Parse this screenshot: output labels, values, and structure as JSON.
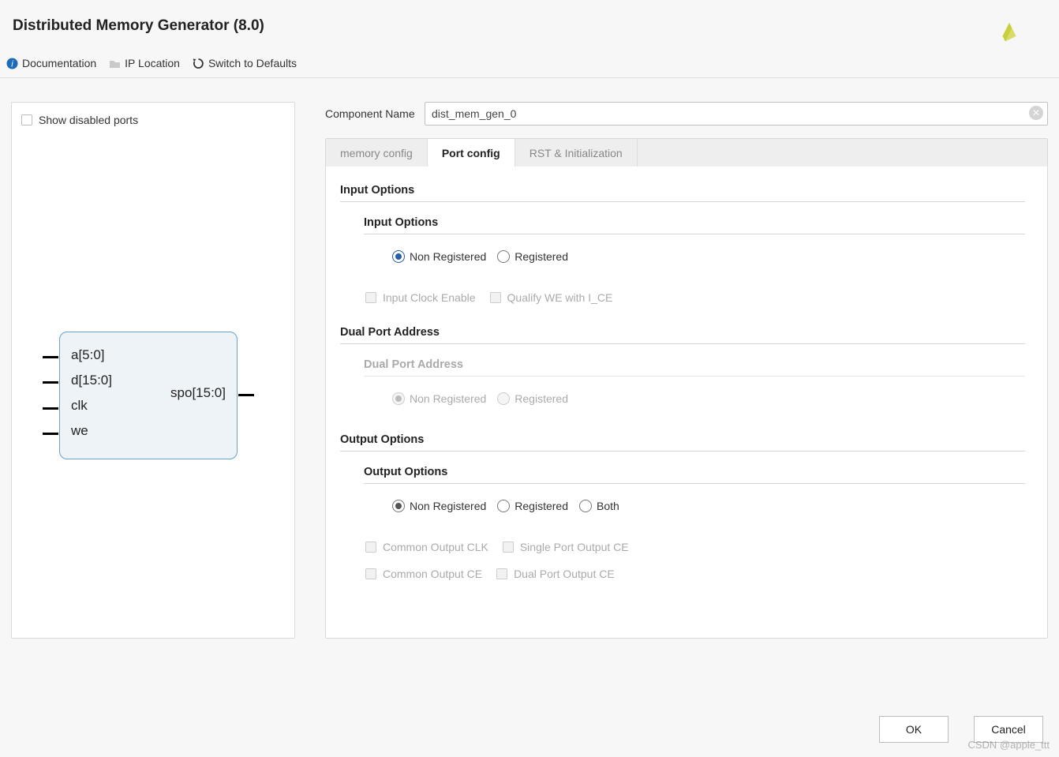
{
  "header": {
    "title": "Distributed Memory Generator (8.0)"
  },
  "toolbar": {
    "documentation": "Documentation",
    "ip_location": "IP Location",
    "switch_defaults": "Switch to Defaults"
  },
  "preview": {
    "show_disabled_label": "Show disabled ports",
    "show_disabled_checked": false,
    "ports_in": [
      "a[5:0]",
      "d[15:0]",
      "clk",
      "we"
    ],
    "port_out": "spo[15:0]"
  },
  "component_name": {
    "label": "Component Name",
    "value": "dist_mem_gen_0"
  },
  "tabs": [
    {
      "id": "memory",
      "label": "memory config",
      "active": false
    },
    {
      "id": "port",
      "label": "Port config",
      "active": true
    },
    {
      "id": "rst",
      "label": "RST & Initialization",
      "active": false
    }
  ],
  "port_config": {
    "input_options_heading": "Input Options",
    "input_options_sub": "Input Options",
    "input_radio": {
      "options": [
        "Non Registered",
        "Registered"
      ],
      "selected": "Non Registered",
      "enabled": true
    },
    "input_checks": [
      {
        "label": "Input Clock Enable",
        "checked": false,
        "enabled": false
      },
      {
        "label": "Qualify WE with I_CE",
        "checked": false,
        "enabled": false
      }
    ],
    "dual_port_heading": "Dual Port Address",
    "dual_port_sub": "Dual Port Address",
    "dual_port_radio": {
      "options": [
        "Non Registered",
        "Registered"
      ],
      "selected": "Non Registered",
      "enabled": false
    },
    "output_options_heading": "Output Options",
    "output_options_sub": "Output Options",
    "output_radio": {
      "options": [
        "Non Registered",
        "Registered",
        "Both"
      ],
      "selected": "Non Registered",
      "enabled": true
    },
    "output_checks_row1": [
      {
        "label": "Common Output CLK",
        "checked": false,
        "enabled": false
      },
      {
        "label": "Single Port Output CE",
        "checked": false,
        "enabled": false
      }
    ],
    "output_checks_row2": [
      {
        "label": "Common Output CE",
        "checked": false,
        "enabled": false
      },
      {
        "label": "Dual Port Output CE",
        "checked": false,
        "enabled": false
      }
    ]
  },
  "footer": {
    "ok": "OK",
    "cancel": "Cancel"
  },
  "watermark": "CSDN @apple_ttt"
}
